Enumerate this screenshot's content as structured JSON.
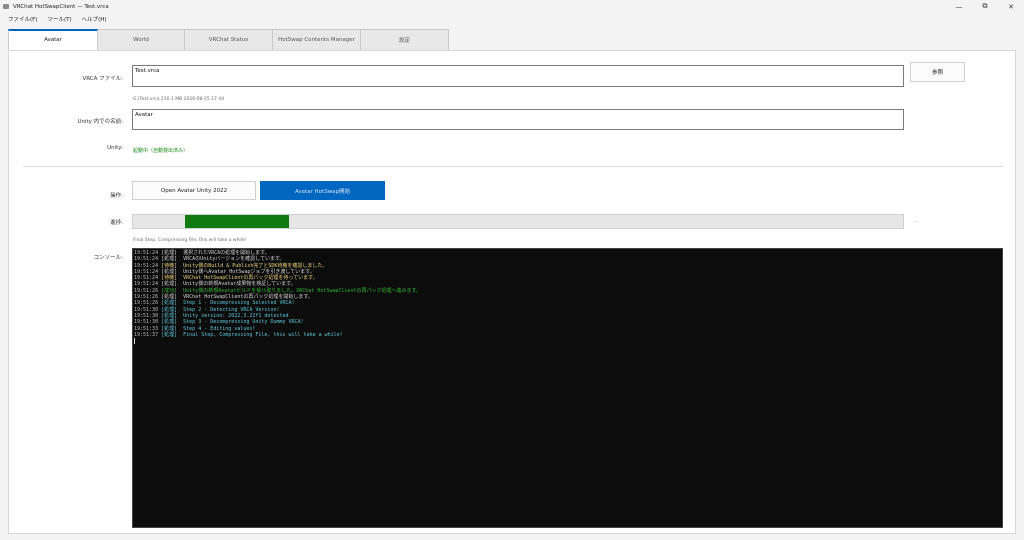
{
  "window": {
    "title": "VRChat HotSwapClient — Test.vrca",
    "controls": [
      "—",
      "⧉",
      "✕"
    ]
  },
  "menu": {
    "items": [
      "ファイル(F)",
      "ツール(T)",
      "ヘルプ(H)"
    ]
  },
  "tabs": [
    {
      "label": "Avatar",
      "active": true,
      "width": 90
    },
    {
      "label": "World",
      "active": false,
      "width": 88
    },
    {
      "label": "VRChat Status",
      "active": false,
      "width": 89
    },
    {
      "label": "HotSwap Contents Manager",
      "active": false,
      "width": 89
    },
    {
      "label": "設定",
      "active": false,
      "width": 89
    }
  ],
  "form": {
    "vrca_label": "VRCA ファイル:",
    "vrca_value": "Test.vrca",
    "browse_label": "参照",
    "file_info": "G:\\Test.vrca   210.1 MB   2026-08-25 17:44",
    "unity_name_label": "Unity 内での名前:",
    "unity_name_value": "Avatar",
    "unity_label": "Unity:",
    "unity_status": "起動中（自動検出済み）"
  },
  "actions": {
    "label": "操作:",
    "open_unity_label": "Open Avatar Unity 2022",
    "hotswap_label": "Avatar HotSwap開始"
  },
  "progress": {
    "label": "進捗:",
    "value": 0.136,
    "start": 0.067,
    "side_text": "...",
    "status_text": "Final Step, Compressing File, this will take a while!"
  },
  "console": {
    "label": "コンソール:",
    "colors": {
      "info": "#cfcfcf",
      "step": "#5ec6d6",
      "warn": "#e8d07a",
      "done": "#33b833"
    },
    "lines": [
      {
        "time": "19:51:24",
        "tag": "[処理]",
        "msg": "選択されたVRCAの処理を開始します。",
        "kind": "info"
      },
      {
        "time": "19:51:24",
        "tag": "[処理]",
        "msg": "VRCAのUnityバージョンを確認しています。",
        "kind": "info"
      },
      {
        "time": "19:51:24",
        "tag": "[待機]",
        "msg": "Unity側のBuild & Publish完了とSDK待機を確認しました。",
        "kind": "warn"
      },
      {
        "time": "19:51:24",
        "tag": "[処理]",
        "msg": "Unity側へAvatar HotSwapジョブを引き渡しています。",
        "kind": "info"
      },
      {
        "time": "19:51:24",
        "tag": "[待機]",
        "msg": "VRChat HotSwapClientの再パック処理を待っています。",
        "kind": "warn"
      },
      {
        "time": "19:51:24",
        "tag": "[処理]",
        "msg": "Unity側の新規Avatar成果物を検証しています。",
        "kind": "info"
      },
      {
        "time": "19:51:26",
        "tag": "[成功]",
        "msg": "Unity側の新規Avatarビルドを受け取りました。VRChat HotSwapClientの再パック処理へ進みます。",
        "kind": "done"
      },
      {
        "time": "19:51:26",
        "tag": "[処理]",
        "msg": "VRChat HotSwapClientの再パック処理を開始します。",
        "kind": "info"
      },
      {
        "time": "19:51:26",
        "tag": "[処理]",
        "msg": "Step 1 - Decompressing Selected VRCA!",
        "kind": "step"
      },
      {
        "time": "19:51:30",
        "tag": "[処理]",
        "msg": "Step 2 - Detecting VRCA Version!",
        "kind": "step"
      },
      {
        "time": "19:51:30",
        "tag": "[処理]",
        "msg": "Unity version: 2022.3.22f1 detected",
        "kind": "step"
      },
      {
        "time": "19:51:30",
        "tag": "[処理]",
        "msg": "Step 3 - Decompressing Unity Dummy VRCA!",
        "kind": "step"
      },
      {
        "time": "19:51:33",
        "tag": "[処理]",
        "msg": "Step 4 - Editing values!",
        "kind": "step"
      },
      {
        "time": "19:51:37",
        "tag": "[処理]",
        "msg": "Final Step, Compressing File, this will take a while!",
        "kind": "step"
      }
    ]
  }
}
